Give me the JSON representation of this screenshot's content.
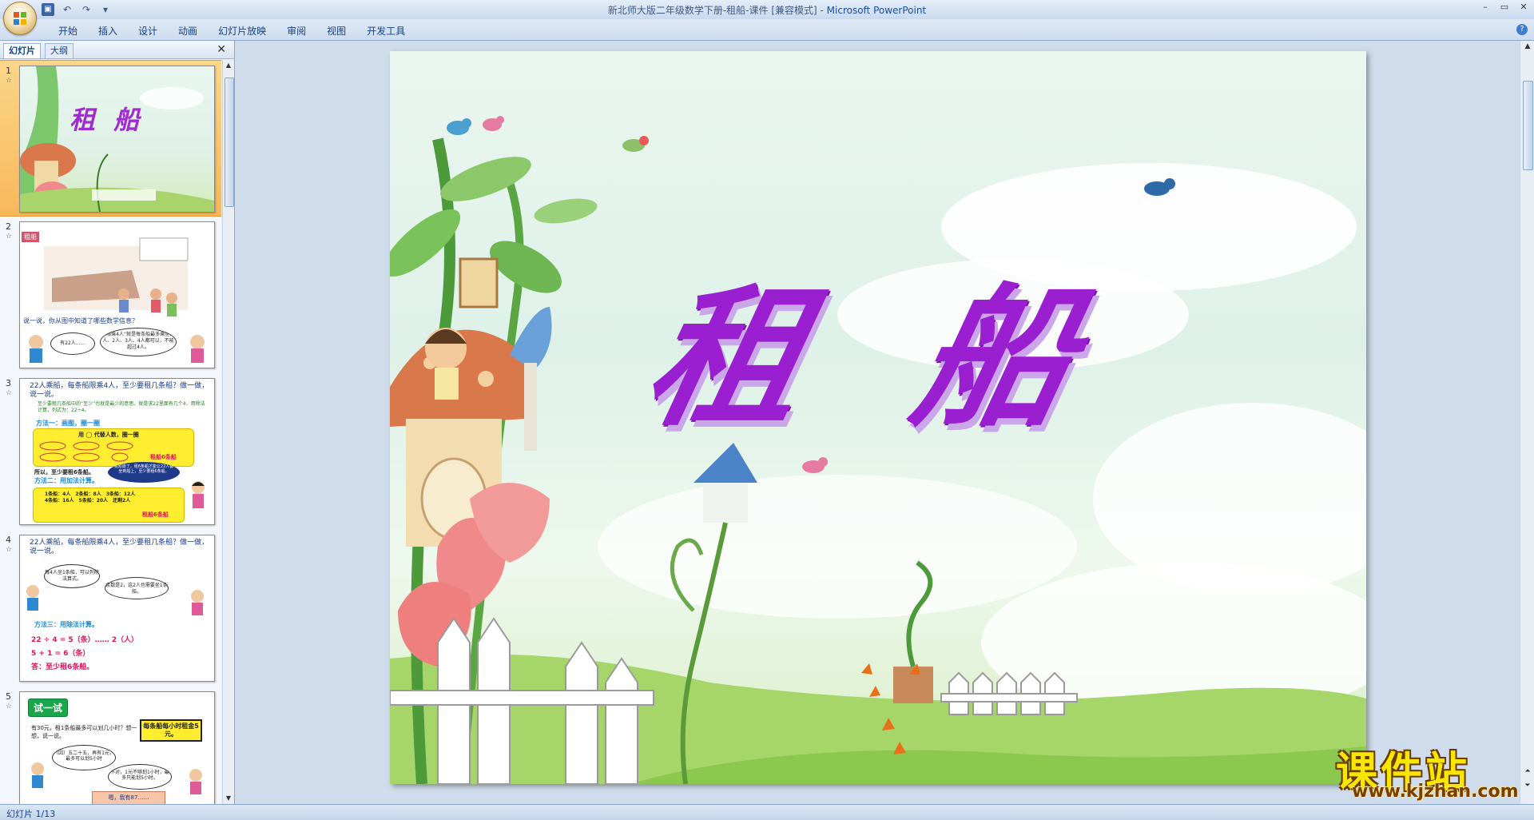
{
  "window": {
    "title_doc": "新北师大版二年级数学下册-租船-课件 [兼容模式]",
    "title_sep": " - ",
    "title_app": "Microsoft PowerPoint",
    "minimize": "–",
    "maximize": "▭",
    "close": "✕"
  },
  "ribbon": {
    "tabs": [
      "开始",
      "插入",
      "设计",
      "动画",
      "幻灯片放映",
      "审阅",
      "视图",
      "开发工具"
    ],
    "help": "?"
  },
  "pane": {
    "tab_slides": "幻灯片",
    "tab_outline": "大纲",
    "close": "✕"
  },
  "thumbnails": [
    {
      "num": "1",
      "star": "☆",
      "title": "租 船"
    },
    {
      "num": "2",
      "star": "☆",
      "tag": "租船",
      "question": "说一说，你从图中知道了哪些数学信息？",
      "bubble1": "有22人……",
      "bubble2": "“限乘4人”就是每条船最多乘坐1人、2人、3人、4人都可以，不能超过4人。"
    },
    {
      "num": "3",
      "star": "☆",
      "line1": "22人乘船，每条船限乘4人，至少要租几条船？做一做，说一说。",
      "line2": "至少要租几条船中的“至少”也就是最少的意思。就是求22里面有几个4，用除法计算，列式为：22÷4。",
      "method1": "方法一：画图，圈一圈",
      "box1_label": "用 ◯ 代替人数，圈一圈",
      "box1_result": "租船6条船",
      "conclusion": "所以，至少要租6条船。",
      "method2": "方法二：用加法计算。",
      "cloud": "我知道了，租6条船才能让22人都坐到船上，至少要租6条船。",
      "calc": "1条船：4人　2条船：8人　3条船：12人\n4条船：16人　5条船：20人　还剩2人",
      "box2_result": "租船6条船"
    },
    {
      "num": "4",
      "star": "☆",
      "line1": "22人乘船，每条船限乘4人，至少要租几条船？做一做，说一说。",
      "cloud1": "每4人坐1条船，可以列除法算式。",
      "cloud2": "余数是2，这2人也需要坐1条船。",
      "method3": "方法三：用除法计算。",
      "eq1": "22 ÷ 4 = 5（条）…… 2（人）",
      "eq2": "5 + 1 = 6（条）",
      "answer": "答：至少租6条船。"
    },
    {
      "num": "5",
      "star": "☆",
      "badge": "试一试",
      "line1": "有30元，租1条船最多可以划几小时？想一想，说一说。",
      "box": "每条船每小时租金5元。",
      "cloud1": "（因）五二十五，再有1元，最多可以划5小时",
      "cloud2": "不对，1元不够划1小时，最多只能划5小时。",
      "strip": "嗯，我有87……"
    }
  ],
  "slide": {
    "title": "租 船"
  },
  "watermark": {
    "cn": "课件站",
    "url": "www.kjzhan.com"
  },
  "status": {
    "text": "幻灯片 1/13"
  },
  "colors": {
    "title_purple": "#9a1fd0",
    "selected_thumb": "#f8b85a",
    "ribbon_blue": "#15428b"
  }
}
